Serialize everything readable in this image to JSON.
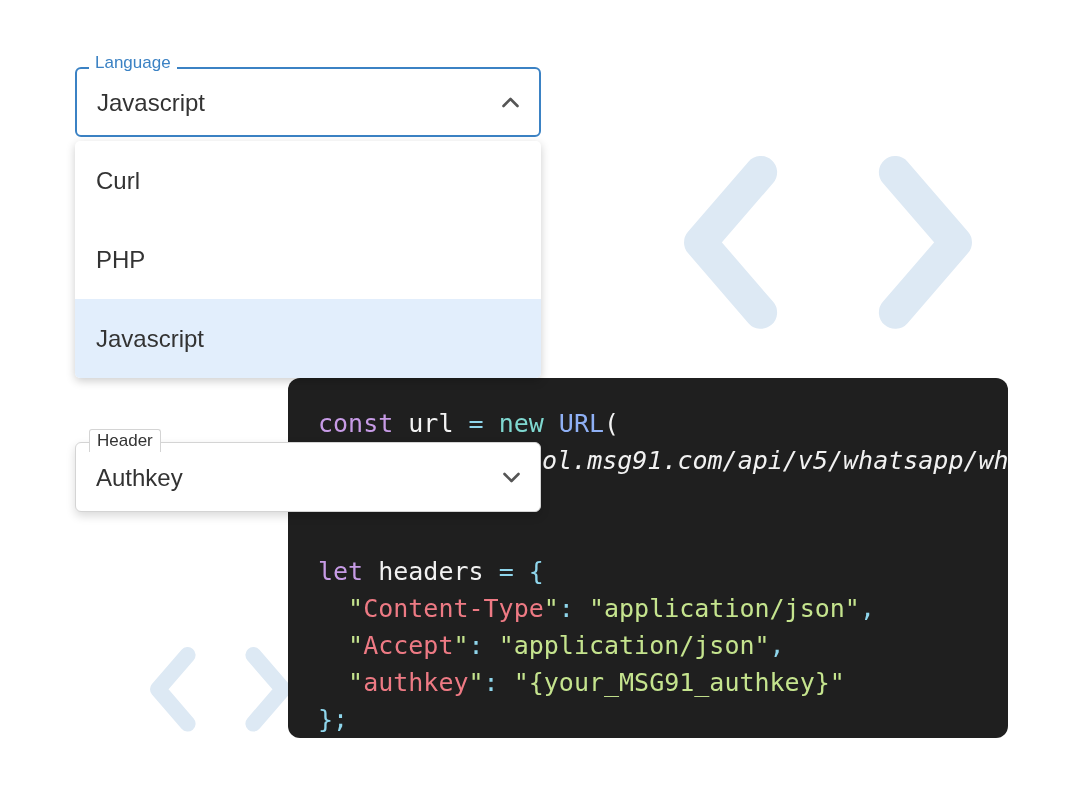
{
  "language_select": {
    "label": "Language",
    "value": "Javascript",
    "open": true,
    "options": [
      {
        "label": "Curl",
        "selected": false
      },
      {
        "label": "PHP",
        "selected": false
      },
      {
        "label": "Javascript",
        "selected": true
      }
    ]
  },
  "header_select": {
    "label": "Header",
    "value": "Authkey",
    "open": false
  },
  "code": {
    "lines": [
      {
        "kind": "code",
        "tokens": [
          {
            "text": "const",
            "kind": "keyword"
          },
          {
            "text": " url ",
            "kind": "plain"
          },
          {
            "text": "=",
            "kind": "punct"
          },
          {
            "text": " new",
            "kind": "new"
          },
          {
            "text": " URL",
            "kind": "class"
          },
          {
            "text": "(",
            "kind": "plain"
          }
        ]
      },
      {
        "kind": "covered",
        "tokens": [
          {
            "text": "ol.msg91.com/api/v5/whatsapp/wh",
            "kind": "italic"
          }
        ]
      },
      {
        "kind": "blank"
      },
      {
        "kind": "blank"
      },
      {
        "kind": "code",
        "tokens": [
          {
            "text": "let",
            "kind": "keyword"
          },
          {
            "text": " headers ",
            "kind": "plain"
          },
          {
            "text": "=",
            "kind": "punct"
          },
          {
            "text": " {",
            "kind": "punct"
          }
        ]
      },
      {
        "kind": "code",
        "tokens": [
          {
            "text": "  \"",
            "kind": "string"
          },
          {
            "text": "Content-Type",
            "kind": "key"
          },
          {
            "text": "\"",
            "kind": "string"
          },
          {
            "text": ": ",
            "kind": "punct"
          },
          {
            "text": "\"application/json\"",
            "kind": "string"
          },
          {
            "text": ",",
            "kind": "punct"
          }
        ]
      },
      {
        "kind": "code",
        "tokens": [
          {
            "text": "  \"",
            "kind": "string"
          },
          {
            "text": "Accept",
            "kind": "key"
          },
          {
            "text": "\"",
            "kind": "string"
          },
          {
            "text": ": ",
            "kind": "punct"
          },
          {
            "text": "\"application/json\"",
            "kind": "string"
          },
          {
            "text": ",",
            "kind": "punct"
          }
        ]
      },
      {
        "kind": "code",
        "tokens": [
          {
            "text": "  \"",
            "kind": "string"
          },
          {
            "text": "authkey",
            "kind": "key"
          },
          {
            "text": "\"",
            "kind": "string"
          },
          {
            "text": ": ",
            "kind": "punct"
          },
          {
            "text": "\"{your_MSG91_authkey}\"",
            "kind": "string"
          }
        ]
      },
      {
        "kind": "code",
        "tokens": [
          {
            "text": "};",
            "kind": "punct"
          }
        ]
      }
    ]
  }
}
